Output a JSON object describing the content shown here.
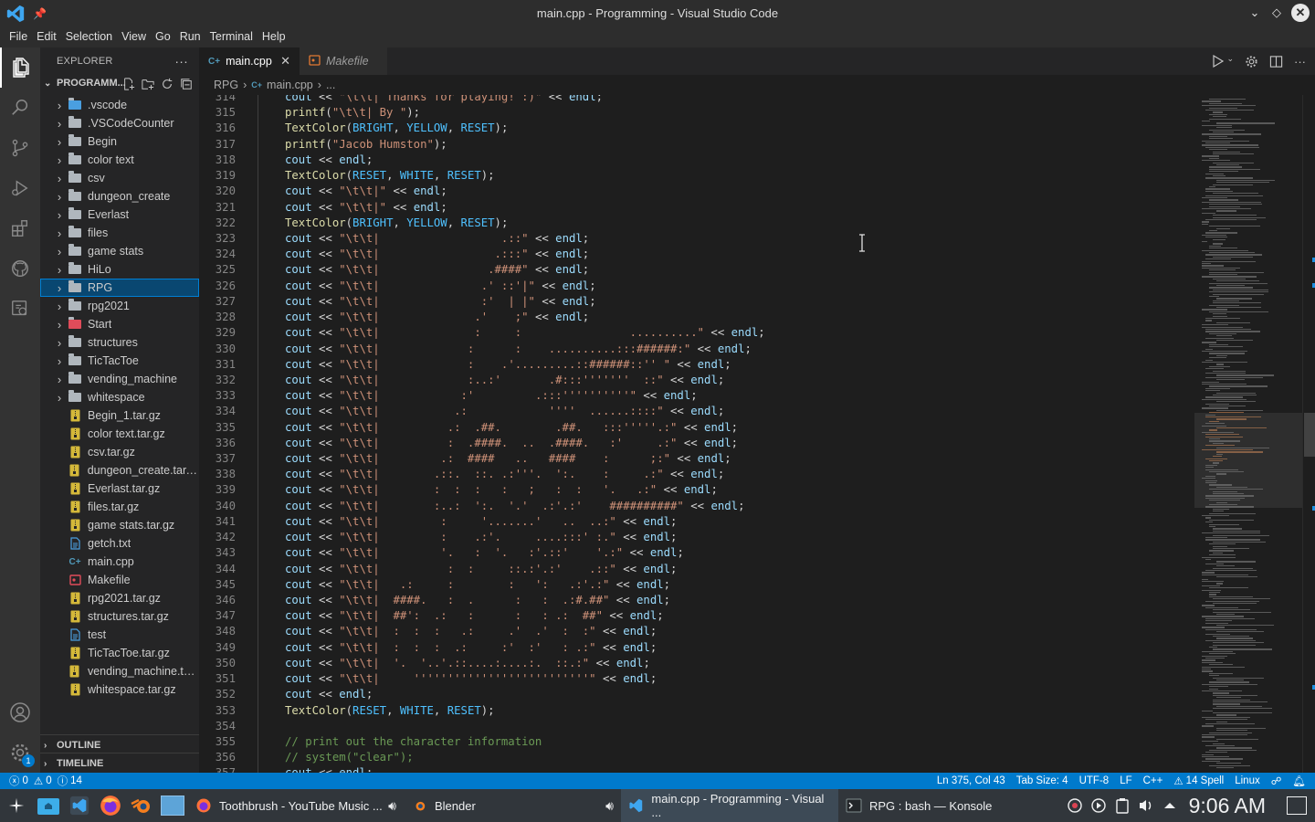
{
  "window": {
    "title": "main.cpp - Programming - Visual Studio Code"
  },
  "menu": [
    "File",
    "Edit",
    "Selection",
    "View",
    "Go",
    "Run",
    "Terminal",
    "Help"
  ],
  "explorer": {
    "header": "EXPLORER",
    "root": "PROGRAMM...",
    "items": [
      {
        "label": ".vscode",
        "type": "folder",
        "icon_color": "#4a9fe0"
      },
      {
        "label": ".VSCodeCounter",
        "type": "folder",
        "icon_color": "#b0b7bd"
      },
      {
        "label": "Begin",
        "type": "folder",
        "icon_color": "#b0b7bd"
      },
      {
        "label": "color text",
        "type": "folder",
        "icon_color": "#b0b7bd"
      },
      {
        "label": "csv",
        "type": "folder",
        "icon_color": "#b0b7bd"
      },
      {
        "label": "dungeon_create",
        "type": "folder",
        "icon_color": "#b0b7bd"
      },
      {
        "label": "Everlast",
        "type": "folder",
        "icon_color": "#b0b7bd"
      },
      {
        "label": "files",
        "type": "folder",
        "icon_color": "#b0b7bd"
      },
      {
        "label": "game stats",
        "type": "folder",
        "icon_color": "#b0b7bd"
      },
      {
        "label": "HiLo",
        "type": "folder",
        "icon_color": "#b0b7bd"
      },
      {
        "label": "RPG",
        "type": "folder",
        "icon_color": "#b0b7bd",
        "selected": true
      },
      {
        "label": "rpg2021",
        "type": "folder",
        "icon_color": "#b0b7bd"
      },
      {
        "label": "Start",
        "type": "folder",
        "icon_color": "#e04c5a"
      },
      {
        "label": "structures",
        "type": "folder",
        "icon_color": "#b0b7bd"
      },
      {
        "label": "TicTacToe",
        "type": "folder",
        "icon_color": "#b0b7bd"
      },
      {
        "label": "vending_machine",
        "type": "folder",
        "icon_color": "#b0b7bd"
      },
      {
        "label": "whitespace",
        "type": "folder",
        "icon_color": "#b0b7bd"
      },
      {
        "label": "Begin_1.tar.gz",
        "type": "archive"
      },
      {
        "label": "color text.tar.gz",
        "type": "archive"
      },
      {
        "label": "csv.tar.gz",
        "type": "archive"
      },
      {
        "label": "dungeon_create.tar.gz",
        "type": "archive"
      },
      {
        "label": "Everlast.tar.gz",
        "type": "archive"
      },
      {
        "label": "files.tar.gz",
        "type": "archive"
      },
      {
        "label": "game stats.tar.gz",
        "type": "archive"
      },
      {
        "label": "getch.txt",
        "type": "text"
      },
      {
        "label": "main.cpp",
        "type": "cpp"
      },
      {
        "label": "Makefile",
        "type": "makefile"
      },
      {
        "label": "rpg2021.tar.gz",
        "type": "archive"
      },
      {
        "label": "structures.tar.gz",
        "type": "archive"
      },
      {
        "label": "test",
        "type": "text"
      },
      {
        "label": "TicTacToe.tar.gz",
        "type": "archive"
      },
      {
        "label": "vending_machine.ta...",
        "type": "archive"
      },
      {
        "label": "whitespace.tar.gz",
        "type": "archive"
      }
    ],
    "outline": "OUTLINE",
    "timeline": "TIMELINE"
  },
  "tabs": [
    {
      "label": "main.cpp",
      "active": true,
      "icon": "C++"
    },
    {
      "label": "Makefile",
      "active": false
    }
  ],
  "breadcrumb": {
    "folder": "RPG",
    "file": "main.cpp",
    "tail": "..."
  },
  "editor": {
    "first_line": 314,
    "lines": [
      "    cout << \"\\t\\t| Thanks for playing! :)\" << endl;",
      "    printf(\"\\t\\t| By \");",
      "    TextColor(BRIGHT, YELLOW, RESET);",
      "    printf(\"Jacob Humston\");",
      "    cout << endl;",
      "    TextColor(RESET, WHITE, RESET);",
      "    cout << \"\\t\\t|\" << endl;",
      "    cout << \"\\t\\t|\" << endl;",
      "    TextColor(BRIGHT, YELLOW, RESET);",
      "    cout << \"\\t\\t|                  .::\" << endl;",
      "    cout << \"\\t\\t|                 .:::\" << endl;",
      "    cout << \"\\t\\t|                .####\" << endl;",
      "    cout << \"\\t\\t|               .' ::'|\" << endl;",
      "    cout << \"\\t\\t|               :'  | |\" << endl;",
      "    cout << \"\\t\\t|              .'    ;\" << endl;",
      "    cout << \"\\t\\t|              :     :                ..........\" << endl;",
      "    cout << \"\\t\\t|             :      :    ..........:::######:\" << endl;",
      "    cout << \"\\t\\t|             :    .'.........::######::'' \" << endl;",
      "    cout << \"\\t\\t|             :..:'       .#:::'''''''  ::\" << endl;",
      "    cout << \"\\t\\t|            :'         .:::''''''''''\" << endl;",
      "    cout << \"\\t\\t|           .:            ''''  ......::::\" << endl;",
      "    cout << \"\\t\\t|          .:  .##.        .##.   :::'''''.:\" << endl;",
      "    cout << \"\\t\\t|          :  .####.  ..  .####.   :'     .:\" << endl;",
      "    cout << \"\\t\\t|         .:  ####   ..   ####    :      ;:\" << endl;",
      "    cout << \"\\t\\t|        .::.  ::. .:'''.  ':.    :     .:\" << endl;",
      "    cout << \"\\t\\t|        :  :  :   :   ;   :  :   '.   .:\" << endl;",
      "    cout << \"\\t\\t|        :..:  ':.  '.'  .:'.:'    ##########\" << endl;",
      "    cout << \"\\t\\t|         :     '.......'   ..  ..:\" << endl;",
      "    cout << \"\\t\\t|         :    .:'.     ....:::' :.\" << endl;",
      "    cout << \"\\t\\t|         '.   :  '.   :'.::'    '.:\" << endl;",
      "    cout << \"\\t\\t|          :  :     ::.:'.:'    .::\" << endl;",
      "    cout << \"\\t\\t|   .:     :        :   ':   .:'.:\" << endl;",
      "    cout << \"\\t\\t|  ####.   :  .      :   :  .:#.##\" << endl;",
      "    cout << \"\\t\\t|  ##':  .:   :      :   : .:  ##\" << endl;",
      "    cout << \"\\t\\t|  :  :  :   .:     .'  .'  :  :\" << endl;",
      "    cout << \"\\t\\t|  :  :  :  .:     :'  :'   : .:\" << endl;",
      "    cout << \"\\t\\t|  '.  '..'.::....:....:.  ::.:\" << endl;",
      "    cout << \"\\t\\t|     ''''''''''''''''''''''''''\" << endl;",
      "    cout << endl;",
      "    TextColor(RESET, WHITE, RESET);",
      "",
      "    // print out the character information",
      "    // system(\"clear\");",
      "    cout << endl;"
    ]
  },
  "statusbar": {
    "errors": "0",
    "warnings": "0",
    "info": "14",
    "position": "Ln 375, Col 43",
    "tab_size": "Tab Size: 4",
    "encoding": "UTF-8",
    "eol": "LF",
    "language": "C++",
    "spell": "14 Spell",
    "platform": "Linux"
  },
  "taskbar": {
    "tasks": [
      {
        "label": "Toothbrush - YouTube Music ...",
        "icon": "firefox-icon"
      },
      {
        "label": "Blender",
        "icon": "blender-icon"
      },
      {
        "label": "main.cpp - Programming - Visual ...",
        "icon": "vscode-icon",
        "active": true
      },
      {
        "label": "RPG : bash — Konsole",
        "icon": "konsole-icon"
      }
    ],
    "clock": "9:06 AM"
  },
  "colors": {
    "accent": "#007acc",
    "selected_row": "#094771",
    "taskbar": "#31363b"
  }
}
